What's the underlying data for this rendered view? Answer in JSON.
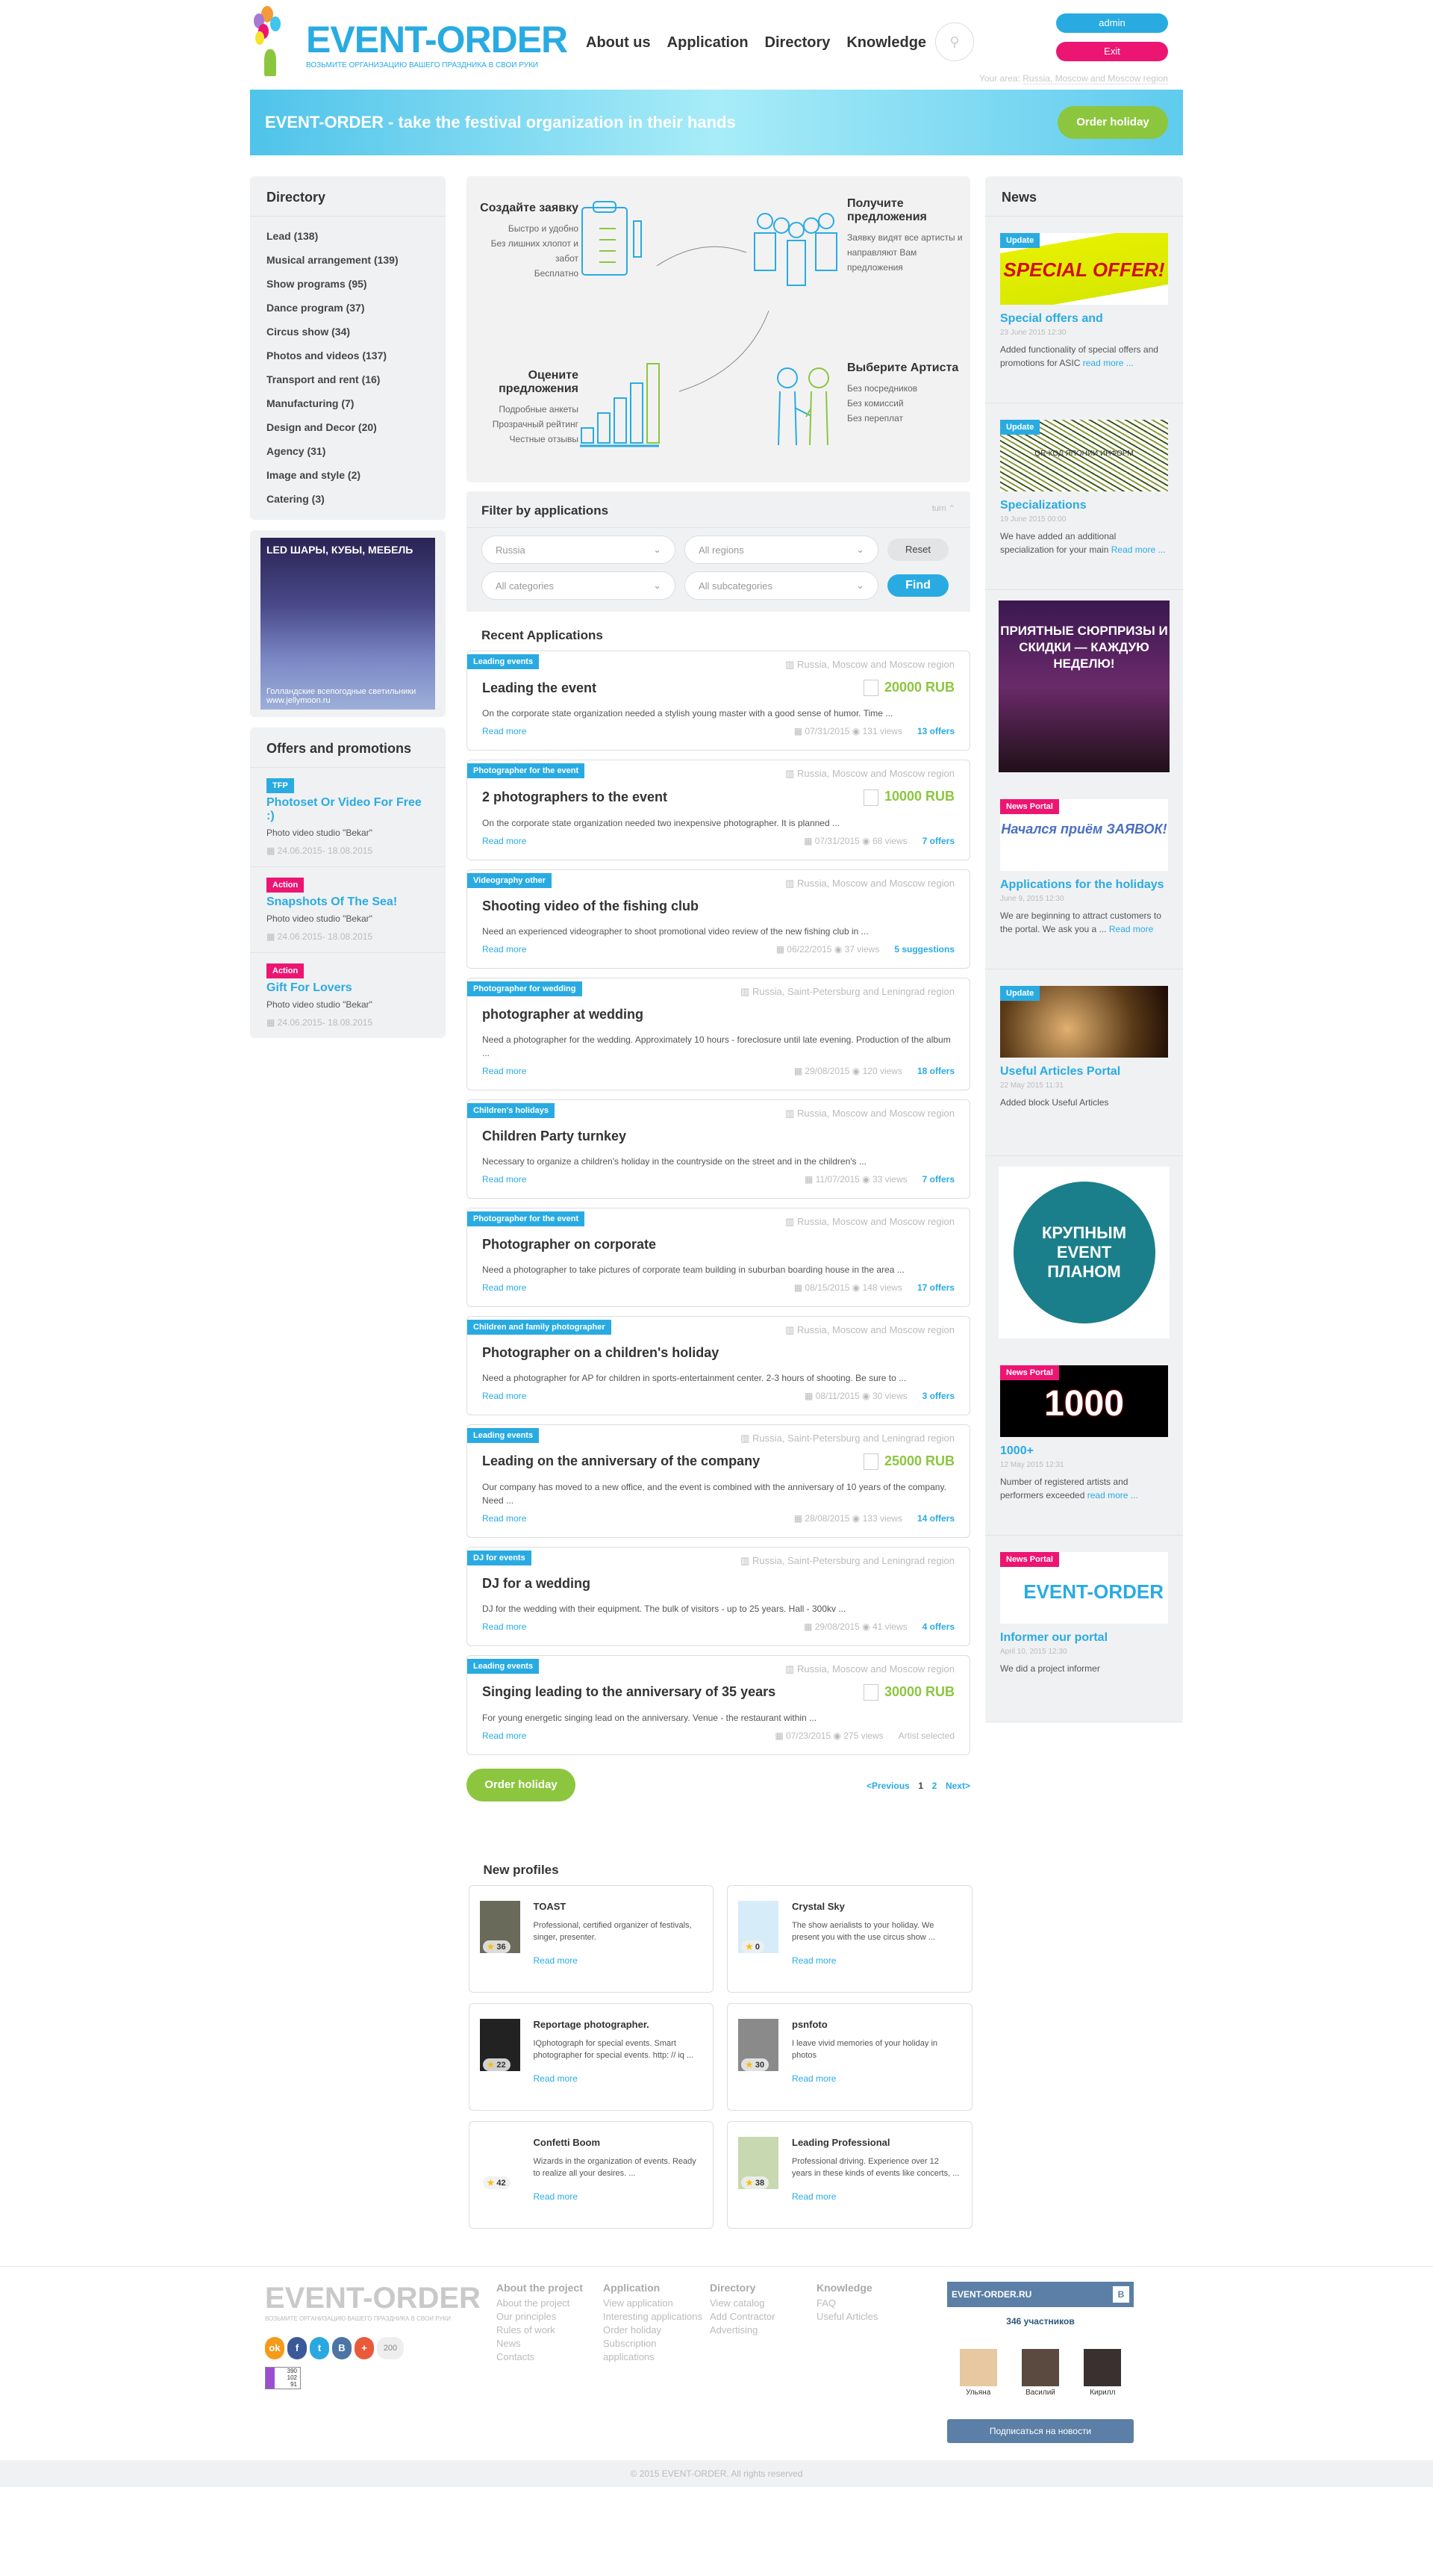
{
  "header": {
    "logo_title": "EVENT-ORDER",
    "logo_subtitle": "ВОЗЬМИТЕ ОРГАНИЗАЦИЮ ВАШЕГО ПРАЗДНИКА В СВОИ РУКИ",
    "nav": [
      "About us",
      "Application",
      "Directory",
      "Knowledge"
    ],
    "search_icon": "search-icon",
    "admin_label": "admin",
    "exit_label": "Exit",
    "area_label": "Your area:",
    "area_value": "Russia, Moscow and Moscow region"
  },
  "banner": {
    "title": "EVENT-ORDER - take the festival organization in their hands",
    "button": "Order holiday"
  },
  "directory": {
    "title": "Directory",
    "items": [
      "Lead (138)",
      "Musical arrangement (139)",
      "Show programs (95)",
      "Dance program (37)",
      "Circus show (34)",
      "Photos and videos (137)",
      "Transport and rent (16)",
      "Manufacturing (7)",
      "Design and Decor (20)",
      "Agency (31)",
      "Image and style (2)",
      "Catering (3)"
    ]
  },
  "ad_left": {
    "top": "LED ШАРЫ, КУБЫ, МЕБЕЛЬ",
    "bottom": "Голландские всепогодные светильники www.jellymoon.ru"
  },
  "offers": {
    "title": "Offers and promotions",
    "items": [
      {
        "tag": "TFP",
        "title": "Photoset Or Video For Free :)",
        "studio": "Photo video studio \"Bekar\"",
        "dates": "24.06.2015- 18.08.2015"
      },
      {
        "tag": "Action",
        "title": "Snapshots Of The Sea!",
        "studio": "Photo video studio \"Bekar\"",
        "dates": "24.06.2015- 18.08.2015"
      },
      {
        "tag": "Action",
        "title": "Gift For Lovers",
        "studio": "Photo video studio \"Bekar\"",
        "dates": "24.06.2015- 18.08.2015"
      }
    ]
  },
  "infographic": {
    "step1": {
      "title": "Создайте заявку",
      "lines": [
        "Быстро и удобно",
        "Без лишних хлопот и забот",
        "Бесплатно"
      ]
    },
    "step2": {
      "title": "Получите предложения",
      "lines": [
        "Заявку видят все артисты и направляют Вам предложения"
      ]
    },
    "step3": {
      "title": "Оцените предложения",
      "lines": [
        "Подробные анкеты",
        "Прозрачный рейтинг",
        "Честные отзывы"
      ]
    },
    "step4": {
      "title": "Выберите Артиста",
      "lines": [
        "Без посредников",
        "Без комиссий",
        "Без переплат"
      ]
    }
  },
  "filter": {
    "title": "Filter by applications",
    "toggle": "turn",
    "country": "Russia",
    "region": "All regions",
    "category": "All categories",
    "subcategory": "All subcategories",
    "reset": "Reset",
    "find": "Find"
  },
  "recent": {
    "title": "Recent Applications",
    "read_more": "Read more",
    "items": [
      {
        "tag": "Leading events",
        "location": "Russia, Moscow and Moscow region",
        "title": "Leading the event",
        "price": "20000 RUB",
        "desc": "On the corporate state organization needed a stylish young master with a good sense of humor. Time ...",
        "date": "07/31/2015",
        "views": "131 views",
        "offers": "13 offers"
      },
      {
        "tag": "Photographer for the event",
        "location": "Russia, Moscow and Moscow region",
        "title": "2 photographers to the event",
        "price": "10000 RUB",
        "desc": "On the corporate state organization needed two inexpensive photographer. It is planned ...",
        "date": "07/31/2015",
        "views": "68 views",
        "offers": "7 offers"
      },
      {
        "tag": "Videography other",
        "location": "Russia, Moscow and Moscow region",
        "title": "Shooting video of the fishing club",
        "price": "",
        "desc": "Need an experienced videographer to shoot promotional video review of the new fishing club in ...",
        "date": "06/22/2015",
        "views": "37 views",
        "offers": "5 suggestions"
      },
      {
        "tag": "Photographer for wedding",
        "location": "Russia, Saint-Petersburg and Leningrad region",
        "title": "photographer at wedding",
        "price": "",
        "desc": "Need a photographer for the wedding. Approximately 10 hours - foreclosure until late evening. Production of the album ...",
        "date": "29/08/2015",
        "views": "120 views",
        "offers": "18 offers"
      },
      {
        "tag": "Children's holidays",
        "location": "Russia, Moscow and Moscow region",
        "title": "Children Party turnkey",
        "price": "",
        "desc": "Necessary to organize a children's holiday in the countryside on the street and in the children's ...",
        "date": "11/07/2015",
        "views": "33 views",
        "offers": "7 offers"
      },
      {
        "tag": "Photographer for the event",
        "location": "Russia, Moscow and Moscow region",
        "title": "Photographer on corporate",
        "price": "",
        "desc": "Need a photographer to take pictures of corporate team building in suburban boarding house in the area ...",
        "date": "08/15/2015",
        "views": "148 views",
        "offers": "17 offers"
      },
      {
        "tag": "Children and family photographer",
        "location": "Russia, Moscow and Moscow region",
        "title": "Photographer on a children's holiday",
        "price": "",
        "desc": "Need a photographer for AP for children in sports-entertainment center. 2-3 hours of shooting. Be sure to ...",
        "date": "08/11/2015",
        "views": "30 views",
        "offers": "3 offers"
      },
      {
        "tag": "Leading events",
        "location": "Russia, Saint-Petersburg and Leningrad region",
        "title": "Leading on the anniversary of the company",
        "price": "25000 RUB",
        "desc": "Our company has moved to a new office, and the event is combined with the anniversary of 10 years of the company. Need ...",
        "date": "28/08/2015",
        "views": "133 views",
        "offers": "14 offers"
      },
      {
        "tag": "DJ for events",
        "location": "Russia, Saint-Petersburg and Leningrad region",
        "title": "DJ for a wedding",
        "price": "",
        "desc": "DJ for the wedding with their equipment. The bulk of visitors - up to 25 years. Hall - 300kv ...",
        "date": "29/08/2015",
        "views": "41 views",
        "offers": "4 offers"
      },
      {
        "tag": "Leading events",
        "location": "Russia, Moscow and Moscow region",
        "title": "Singing leading to the anniversary of 35 years",
        "price": "30000 RUB",
        "desc": "For young energetic singing lead on the anniversary. Venue - the restaurant within ...",
        "date": "07/23/2015",
        "views": "275 views",
        "offers": "",
        "status": "Artist selected"
      }
    ],
    "order_button": "Order holiday",
    "pager": {
      "prev": "<Previous",
      "pages": [
        "1",
        "2"
      ],
      "next": "Next>"
    }
  },
  "news": {
    "title": "News",
    "items": [
      {
        "tag": "Update",
        "img_text": "SPECIAL OFFER!",
        "title": "Special offers and",
        "date": "23 June 2015 12:30",
        "text": "Added functionality of special offers and promotions for ASIC",
        "more": "read more ..."
      },
      {
        "tag": "Update",
        "img_text": "QR-КОД ЯПОНИИ ИНФОРМ",
        "title": "Specializations",
        "date": "19 June 2015 00:00",
        "text": "We have added an additional specialization for your main",
        "more": "Read more ..."
      },
      {
        "tag": "News Portal",
        "img_text": "Начался приём ЗАЯВОК!",
        "title": "Applications for the holidays",
        "date": "June 9, 2015 12:30",
        "text": "We are beginning to attract customers to the portal. We ask you a ...",
        "more": "Read more"
      },
      {
        "tag": "Update",
        "img_text": "",
        "title": "Useful Articles Portal",
        "date": "22 May 2015 11:31",
        "text": "Added block Useful Articles",
        "more": ""
      },
      {
        "tag": "News Portal",
        "img_text": "1000",
        "title": "1000+",
        "date": "12 May 2015 12:31",
        "text": "Number of registered artists and performers exceeded",
        "more": "read more ..."
      },
      {
        "tag": "News Portal",
        "img_text": "EVENT-ORDER",
        "title": "Informer our portal",
        "date": "April 10, 2015 12:30",
        "text": "We did a project informer",
        "more": ""
      }
    ],
    "ad1": "ПРИЯТНЫЕ СЮРПРИЗЫ И СКИДКИ — КАЖДУЮ НЕДЕЛЮ!",
    "ad2": "КРУПНЫМ EVENT ПЛАНОМ"
  },
  "profiles": {
    "title": "New profiles",
    "read_more": "Read more",
    "items": [
      {
        "name": "TOAST",
        "desc": "Professional, certified organizer of festivals, singer, presenter.",
        "rating": "36"
      },
      {
        "name": "Crystal Sky",
        "desc": "The show aerialists to your holiday. We present you with the use circus show ...",
        "rating": "0"
      },
      {
        "name": "Reportage photographer.",
        "desc": "IQphotograph for special events. Smart photographer for special events. http: // iq ...",
        "rating": "22"
      },
      {
        "name": "psnfoto",
        "desc": "I leave vivid memories of your holiday in photos",
        "rating": "30"
      },
      {
        "name": "Confetti Boom",
        "desc": "Wizards in the organization of events. Ready to realize all your desires. ...",
        "rating": "42"
      },
      {
        "name": "Leading Professional",
        "desc": "Professional driving. Experience over 12 years in these kinds of events like concerts, ...",
        "rating": "38"
      }
    ]
  },
  "footer": {
    "logo_title": "EVENT-ORDER",
    "logo_subtitle": "ВОЗЬМИТЕ ОРГАНИЗАЦИЮ ВАШЕГО ПРАЗДНИКА В СВОИ РУКИ",
    "share_count": "200",
    "counter": [
      "390",
      "102",
      "91"
    ],
    "columns": [
      {
        "title": "About the project",
        "links": [
          "About the project",
          "Our principles",
          "Rules of work",
          "News",
          "Contacts"
        ]
      },
      {
        "title": "Application",
        "links": [
          "View application",
          "Interesting applications",
          "Order holiday",
          "Subscription applications"
        ]
      },
      {
        "title": "Directory",
        "links": [
          "View catalog",
          "Add Contractor",
          "Advertising"
        ]
      },
      {
        "title": "Knowledge",
        "links": [
          "FAQ",
          "Useful Articles"
        ]
      }
    ],
    "vk": {
      "name": "EVENT-ORDER.RU",
      "members": "346 участников",
      "people": [
        "Ульяна",
        "Василий",
        "Кирилл"
      ],
      "subscribe": "Подписаться на новости"
    },
    "copyright": "© 2015 EVENT-ORDER. All rights reserved"
  },
  "colors": {
    "accent": "#29abe2",
    "pink": "#ed1572",
    "green": "#8cc63f",
    "vk": "#5b7fa6"
  }
}
